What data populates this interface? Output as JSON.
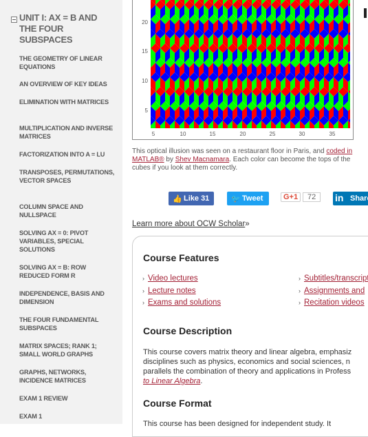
{
  "sidebar": {
    "unit_title": "UNIT I: AX = B AND THE FOUR SUBSPACES",
    "items": [
      {
        "label": "THE GEOMETRY OF LINEAR EQUATIONS"
      },
      {
        "label": "AN OVERVIEW OF KEY IDEAS"
      },
      {
        "label": "ELIMINATION WITH MATRICES"
      },
      {
        "label": "MULTIPLICATION AND INVERSE MATRICES"
      },
      {
        "label": "FACTORIZATION INTO A = LU"
      },
      {
        "label": "TRANSPOSES, PERMUTATIONS, VECTOR SPACES"
      },
      {
        "label": "COLUMN SPACE AND NULLSPACE"
      },
      {
        "label": "SOLVING AX = 0: PIVOT VARIABLES, SPECIAL SOLUTIONS"
      },
      {
        "label": "SOLVING AX = B: ROW REDUCED FORM R"
      },
      {
        "label": "INDEPENDENCE, BASIS AND DIMENSION"
      },
      {
        "label": "THE FOUR FUNDAMENTAL SUBSPACES"
      },
      {
        "label": "MATRIX SPACES; RANK 1; SMALL WORLD GRAPHS"
      },
      {
        "label": "GRAPHS, NETWORKS, INCIDENCE MATRICES"
      },
      {
        "label": "EXAM 1 REVIEW"
      },
      {
        "label": "EXAM 1"
      }
    ]
  },
  "figure": {
    "y_ticks": [
      "20",
      "15",
      "10",
      "5"
    ],
    "x_ticks": [
      "5",
      "10",
      "15",
      "20",
      "25",
      "30",
      "35"
    ],
    "colors": {
      "red": "#ff0000",
      "green": "#00ff00",
      "blue": "#0000ff"
    }
  },
  "caption": {
    "text1": "This optical illusion was seen on a restaurant floor in Paris, and",
    "link1": "coded in MATLAB®",
    "by": " by ",
    "link2": "Shev Macnamara",
    "text2": ". Each color can become the tops of the cubes if you look at them correctly."
  },
  "social": {
    "facebook": "Like 31",
    "twitter": "Tweet",
    "gplus": "G+1",
    "gplus_count": "72",
    "linkedin": "Share"
  },
  "learn_more": {
    "link": "Learn more about OCW Scholar",
    "suffix": "»"
  },
  "course_features": {
    "heading": "Course Features",
    "left": [
      "Video lectures",
      "Lecture notes",
      "Exams and solutions"
    ],
    "right": [
      "Subtitles/transcript",
      "Assignments and",
      "Recitation videos"
    ]
  },
  "course_description": {
    "heading": "Course Description",
    "line1": "This course covers matrix theory and linear algebra, emphasiz",
    "line2": "disciplines such as physics, economics and social sciences, n",
    "line3": "parallels the combination of theory and applications in Profess",
    "link": "to Linear Algebra",
    "end": "."
  },
  "course_format": {
    "heading": "Course Format",
    "line1": "This course has been designed for independent study. It"
  }
}
